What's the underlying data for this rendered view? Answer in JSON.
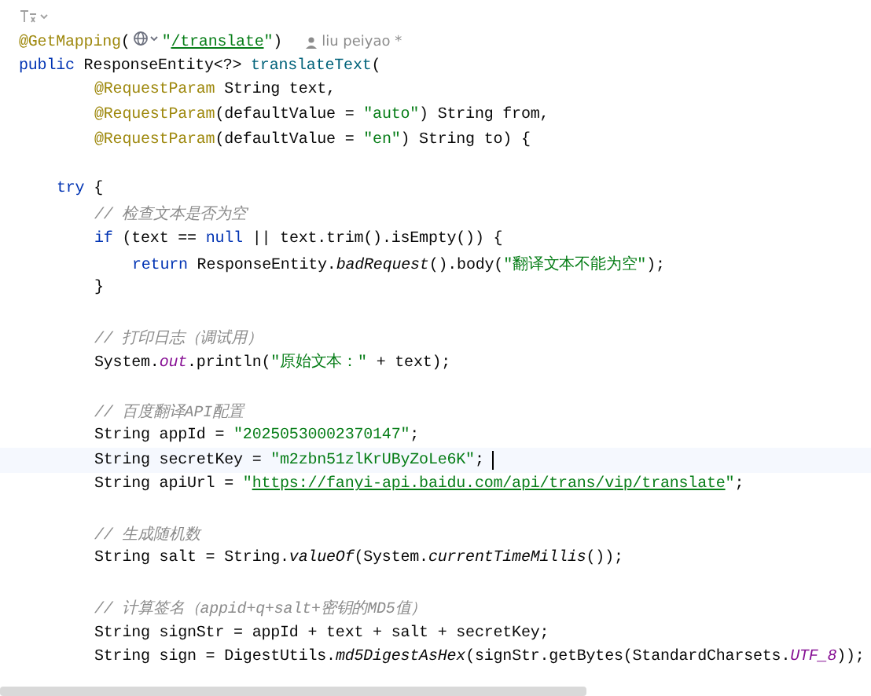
{
  "lines": [
    {
      "kind": "hint"
    },
    {
      "kind": "code",
      "tokens": [
        {
          "kind": "annot",
          "text": "@GetMapping"
        },
        {
          "kind": "plain",
          "text": "("
        },
        {
          "kind": "globe"
        },
        {
          "kind": "str",
          "text": "\""
        },
        {
          "kind": "link",
          "text": "/translate"
        },
        {
          "kind": "str",
          "text": "\""
        },
        {
          "kind": "plain",
          "text": ")"
        }
      ],
      "author": "liu peiyao *"
    },
    {
      "kind": "code",
      "tokens": [
        {
          "kind": "kw",
          "text": "public"
        },
        {
          "kind": "plain",
          "text": " ResponseEntity<?> "
        },
        {
          "kind": "method",
          "text": "translateText"
        },
        {
          "kind": "plain",
          "text": "("
        }
      ],
      "children": [
        {
          "kind": "group",
          "children": [
            {
              "kind": "code",
              "tokens": [
                {
                  "kind": "annot",
                  "text": "@RequestParam"
                },
                {
                  "kind": "plain",
                  "text": " String text,"
                }
              ]
            },
            {
              "kind": "code",
              "tokens": [
                {
                  "kind": "annot",
                  "text": "@RequestParam"
                },
                {
                  "kind": "plain",
                  "text": "(defaultValue = "
                },
                {
                  "kind": "str",
                  "text": "\"auto\""
                },
                {
                  "kind": "plain",
                  "text": ") String from,"
                }
              ]
            },
            {
              "kind": "code",
              "tokens": [
                {
                  "kind": "annot",
                  "text": "@RequestParam"
                },
                {
                  "kind": "plain",
                  "text": "(defaultValue = "
                },
                {
                  "kind": "str",
                  "text": "\"en\""
                },
                {
                  "kind": "plain",
                  "text": ") String to) {"
                }
              ]
            }
          ]
        },
        {
          "kind": "blank"
        },
        {
          "kind": "code",
          "tokens": [
            {
              "kind": "kw",
              "text": "try"
            },
            {
              "kind": "plain",
              "text": " {"
            }
          ],
          "children": [
            {
              "kind": "code",
              "tokens": [
                {
                  "kind": "comment",
                  "text": "// 检查文本是否为空"
                }
              ]
            },
            {
              "kind": "code",
              "tokens": [
                {
                  "kind": "kw",
                  "text": "if"
                },
                {
                  "kind": "plain",
                  "text": " (text == "
                },
                {
                  "kind": "kw",
                  "text": "null"
                },
                {
                  "kind": "plain",
                  "text": " || text.trim().isEmpty()) {"
                }
              ],
              "children": [
                {
                  "kind": "code",
                  "tokens": [
                    {
                      "kind": "kw",
                      "text": "return"
                    },
                    {
                      "kind": "plain",
                      "text": " ResponseEntity."
                    },
                    {
                      "kind": "italic",
                      "text": "badRequest"
                    },
                    {
                      "kind": "plain",
                      "text": "().body("
                    },
                    {
                      "kind": "str",
                      "text": "\"翻译文本不能为空\""
                    },
                    {
                      "kind": "plain",
                      "text": ");"
                    }
                  ]
                }
              ]
            },
            {
              "kind": "code",
              "tokens": [
                {
                  "kind": "plain",
                  "text": "}"
                }
              ]
            },
            {
              "kind": "blank"
            },
            {
              "kind": "code",
              "tokens": [
                {
                  "kind": "comment",
                  "text": "// 打印日志（调试用）"
                }
              ]
            },
            {
              "kind": "code",
              "tokens": [
                {
                  "kind": "plain",
                  "text": "System."
                },
                {
                  "kind": "field",
                  "text": "out"
                },
                {
                  "kind": "plain",
                  "text": ".println("
                },
                {
                  "kind": "str",
                  "text": "\"原始文本：\""
                },
                {
                  "kind": "plain",
                  "text": " + text);"
                }
              ]
            },
            {
              "kind": "blank"
            },
            {
              "kind": "code",
              "tokens": [
                {
                  "kind": "comment",
                  "text": "// 百度翻译API配置"
                }
              ]
            },
            {
              "kind": "code",
              "tokens": [
                {
                  "kind": "plain",
                  "text": "String appId = "
                },
                {
                  "kind": "str",
                  "text": "\"20250530002370147\""
                },
                {
                  "kind": "plain",
                  "text": ";"
                }
              ]
            },
            {
              "kind": "code",
              "tokens": [
                {
                  "kind": "plain",
                  "text": "String secretKey = "
                },
                {
                  "kind": "str",
                  "text": "\"m2zbn51zlKrUByZoLe6K\""
                },
                {
                  "kind": "plain",
                  "text": ";"
                }
              ],
              "current": true
            },
            {
              "kind": "code",
              "tokens": [
                {
                  "kind": "plain",
                  "text": "String apiUrl = "
                },
                {
                  "kind": "str",
                  "text": "\""
                },
                {
                  "kind": "link",
                  "text": "https://fanyi-api.baidu.com/api/trans/vip/translate"
                },
                {
                  "kind": "str",
                  "text": "\""
                },
                {
                  "kind": "plain",
                  "text": ";"
                }
              ]
            },
            {
              "kind": "blank"
            },
            {
              "kind": "code",
              "tokens": [
                {
                  "kind": "comment",
                  "text": "// 生成随机数"
                }
              ]
            },
            {
              "kind": "code",
              "tokens": [
                {
                  "kind": "plain",
                  "text": "String salt = String."
                },
                {
                  "kind": "italic",
                  "text": "valueOf"
                },
                {
                  "kind": "plain",
                  "text": "(System."
                },
                {
                  "kind": "italic",
                  "text": "currentTimeMillis"
                },
                {
                  "kind": "plain",
                  "text": "());"
                }
              ]
            },
            {
              "kind": "blank"
            },
            {
              "kind": "code",
              "tokens": [
                {
                  "kind": "comment",
                  "text": "// 计算签名（appid+q+salt+密钥的MD5值）"
                }
              ]
            },
            {
              "kind": "code",
              "tokens": [
                {
                  "kind": "plain",
                  "text": "String signStr = appId + text + salt + secretKey;"
                }
              ]
            },
            {
              "kind": "code",
              "tokens": [
                {
                  "kind": "plain",
                  "text": "String sign = DigestUtils."
                },
                {
                  "kind": "italic",
                  "text": "md5DigestAsHex"
                },
                {
                  "kind": "plain",
                  "text": "(signStr.getBytes(StandardCharsets."
                },
                {
                  "kind": "field",
                  "text": "UTF_8"
                },
                {
                  "kind": "plain",
                  "text": "));"
                }
              ]
            }
          ]
        }
      ]
    }
  ]
}
